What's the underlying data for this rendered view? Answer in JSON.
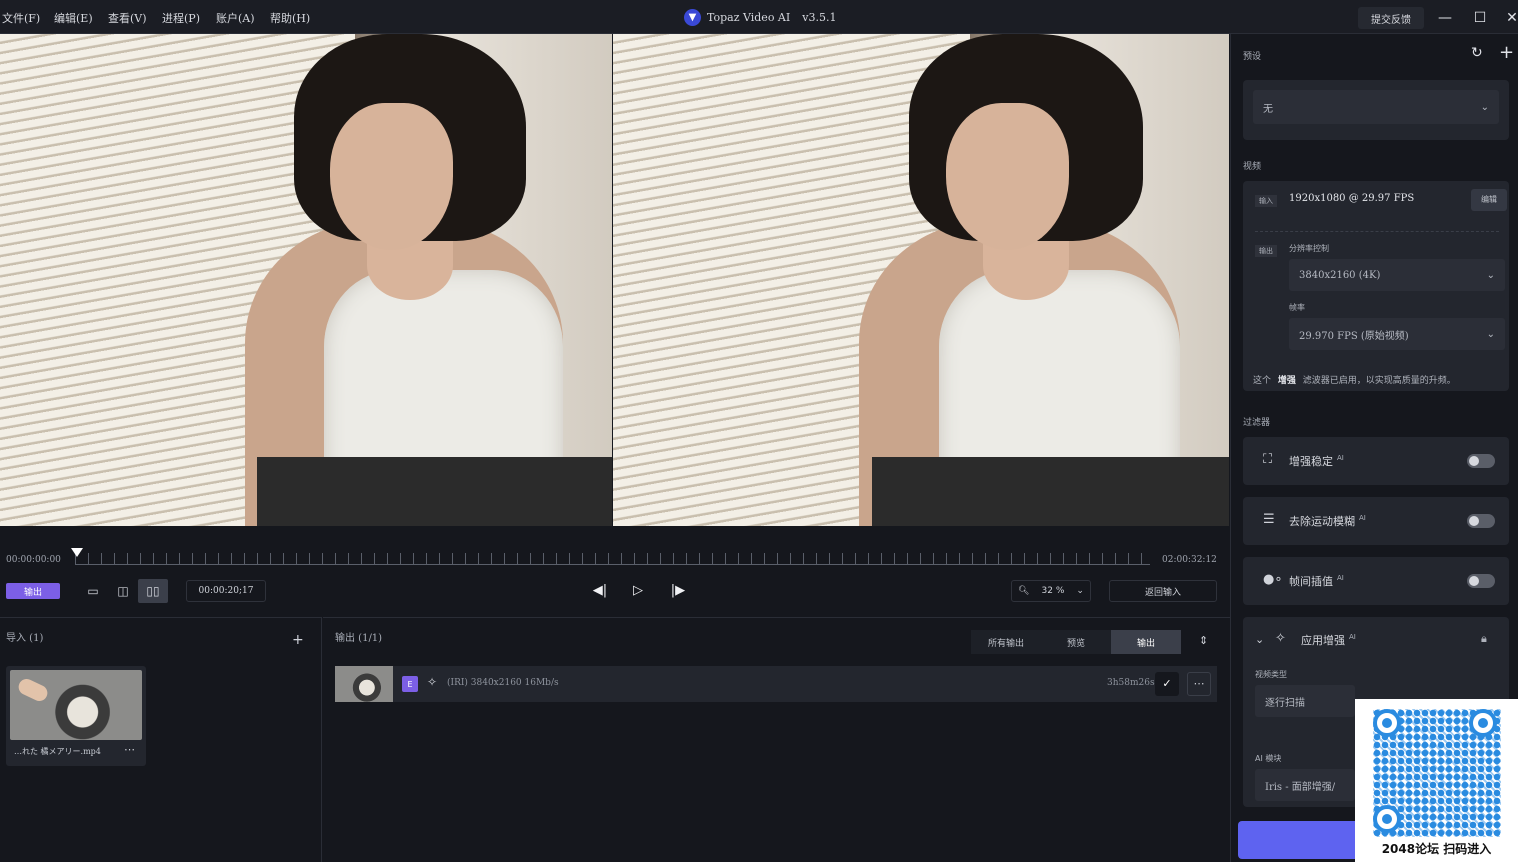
{
  "menu": [
    "文件(F)",
    "编辑(E)",
    "查看(V)",
    "进程(P)",
    "账户(A)",
    "帮助(H)"
  ],
  "app": {
    "name": "Topaz Video AI",
    "version": "v3.5.1",
    "feedback": "提交反馈"
  },
  "timeline": {
    "start": "00:00:00:00",
    "end": "02:00:32:12",
    "current": "00:00:20;17",
    "zoom": "32 %",
    "return_label": "返回输入",
    "export_label": "输出"
  },
  "import_panel": {
    "title": "导入 (1)",
    "file_name": "…れた 橘メアリー.mp4"
  },
  "output_panel": {
    "title": "输出 (1/1)",
    "tabs": [
      "所有输出",
      "预览",
      "输出"
    ],
    "active_tab": "输出",
    "row": {
      "badge": "E",
      "desc": "(IRI) 3840x2160 16Mb/s",
      "duration": "3h58m26s"
    }
  },
  "sidebar": {
    "preset_title": "预设",
    "preset_value": "无",
    "video_title": "视频",
    "input_tag": "输入",
    "input_res": "1920x1080 @ 29.97 FPS",
    "edit_label": "编辑",
    "output_tag": "输出",
    "res_control_label": "分辨率控制",
    "res_value": "3840x2160 (4K)",
    "fps_label": "帧率",
    "fps_value": "29.970 FPS (原始视频)",
    "note_pre": "这个",
    "note_bold": "增强",
    "note_post": "滤波器已启用，以实现高质量的升频。",
    "filters_title": "过滤器",
    "filters": [
      {
        "label": "增强稳定",
        "ai": "AI",
        "on": false
      },
      {
        "label": "去除运动模糊",
        "ai": "AI",
        "on": false
      },
      {
        "label": "帧间插值",
        "ai": "AI",
        "on": false
      }
    ],
    "enhance_label": "应用增强",
    "enhance_ai": "AI",
    "video_type_label": "视频类型",
    "video_type_value": "逐行扫描",
    "ai_model_label": "AI 模块",
    "ai_model_value": "Iris - 面部增强/"
  },
  "watermark": "2048论坛 扫码进入",
  "colors": {
    "accent": "#7c5fe6",
    "primary_button": "#5e63f0",
    "qr": "#2a8be0"
  }
}
